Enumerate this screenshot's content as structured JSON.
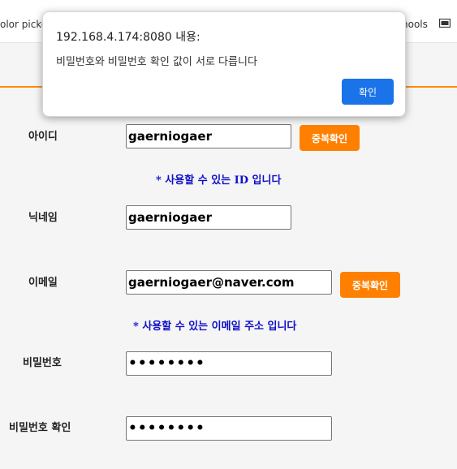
{
  "browser": {
    "bookmark_left": "olor picke",
    "bookmark_right": "hools"
  },
  "form": {
    "id": {
      "label": "아이디",
      "value": "gaerniogaer",
      "check_button": "중복확인",
      "message": "* 사용할 수 있는 ID 입니다"
    },
    "nickname": {
      "label": "닉네임",
      "value": "gaerniogaer"
    },
    "email": {
      "label": "이메일",
      "value": "gaerniogaer@naver.com",
      "check_button": "중복확인",
      "message": "* 사용할 수 있는 이메일 주소 입니다"
    },
    "password": {
      "label": "비밀번호",
      "value": "aaaaaaaa"
    },
    "password_confirm": {
      "label": "비밀번호 확인",
      "value": "aaaaaaaa"
    }
  },
  "dialog": {
    "title": "192.168.4.174:8080 내용:",
    "message": "비밀번호와 비밀번호 확인 값이 서로 다릅니다",
    "ok_button": "확인"
  },
  "colors": {
    "accent": "#ff8000",
    "message": "#1010c8",
    "dialog_button": "#1a73e8"
  }
}
